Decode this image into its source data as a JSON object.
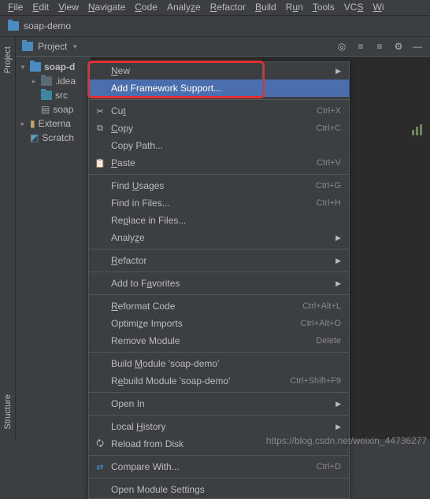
{
  "menubar": {
    "items": [
      "File",
      "Edit",
      "View",
      "Navigate",
      "Code",
      "Analyze",
      "Refactor",
      "Build",
      "Run",
      "Tools",
      "VCS",
      "Window"
    ]
  },
  "breadcrumb": {
    "project": "soap-demo"
  },
  "toolbar": {
    "project_label": "Project"
  },
  "tree": {
    "root": "soap-d",
    "children": [
      ".idea",
      "src",
      "soap"
    ],
    "externals": "Externa",
    "scratches": "Scratch"
  },
  "menu": {
    "new": "New",
    "add_framework": "Add Framework Support...",
    "cut": "Cut",
    "cut_key": "Ctrl+X",
    "copy": "Copy",
    "copy_key": "Ctrl+C",
    "copy_path": "Copy Path...",
    "paste": "Paste",
    "paste_key": "Ctrl+V",
    "find_usages": "Find Usages",
    "find_usages_key": "Ctrl+G",
    "find_in_files": "Find in Files...",
    "find_in_files_key": "Ctrl+H",
    "replace_in_files": "Replace in Files...",
    "analyze": "Analyze",
    "refactor": "Refactor",
    "favorites": "Add to Favorites",
    "reformat": "Reformat Code",
    "reformat_key": "Ctrl+Alt+L",
    "optimize": "Optimize Imports",
    "optimize_key": "Ctrl+Alt+O",
    "remove_module": "Remove Module",
    "remove_module_key": "Delete",
    "build_module": "Build Module 'soap-demo'",
    "rebuild_module": "Rebuild Module 'soap-demo'",
    "rebuild_module_key": "Ctrl+Shift+F9",
    "open_in": "Open In",
    "local_history": "Local History",
    "reload_disk": "Reload from Disk",
    "compare_with": "Compare With...",
    "compare_with_key": "Ctrl+D",
    "open_module_settings": "Open Module Settings"
  },
  "sidebar": {
    "project": "Project",
    "structure": "Structure"
  },
  "watermark": "https://blog.csdn.net/weixin_44736277"
}
